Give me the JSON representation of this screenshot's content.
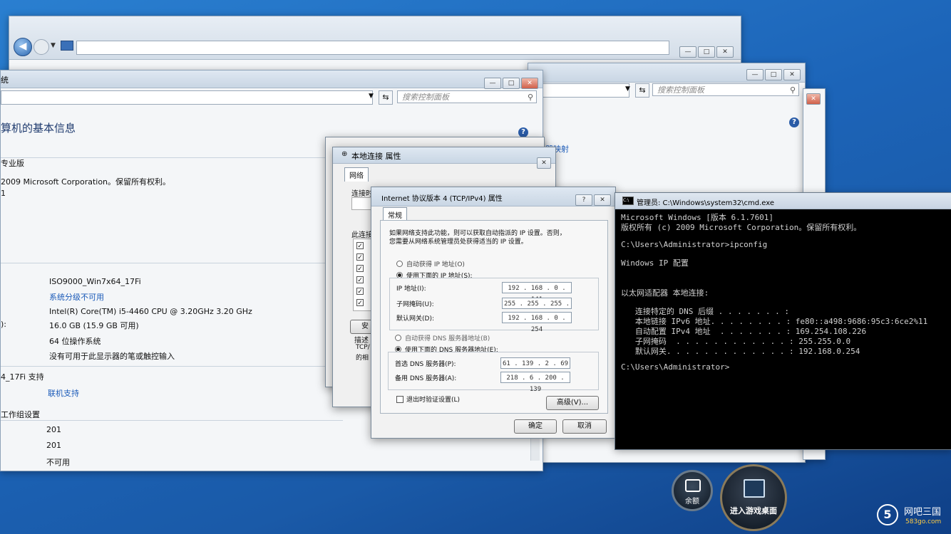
{
  "back_window": {
    "controls": [
      "—",
      "□",
      "✕"
    ]
  },
  "panel_right": {
    "search_placeholder": "搜索控制面板",
    "controls": [
      "—",
      "□",
      "✕"
    ]
  },
  "sysinfo": {
    "title_fragment": "统",
    "search_placeholder": "搜索控制面板",
    "heading": "算机的基本信息",
    "edition": "专业版",
    "copyright": "2009 Microsoft Corporation。保留所有权利。",
    "sp": "1",
    "computer_name": "ISO9000_Win7x64_17Fi",
    "rating": "系统分级不可用",
    "processor": "Intel(R) Core(TM) i5-4460  CPU @ 3.20GHz   3.20 GHz",
    "ram_label": "):",
    "ram": "16.0 GB (15.9 GB 可用)",
    "system_type": "64 位操作系统",
    "pen": "没有可用于此显示器的笔或触控输入",
    "support_label": "4_17Fi 支持",
    "support_link": "联机支持",
    "workgroup_label": "工作组设置",
    "val1": "201",
    "val2": "201",
    "val3": "不可用",
    "side_link": "器映射"
  },
  "local_conn": {
    "title": "本地连接 属性",
    "tab": "网络",
    "connect_label": "连接时",
    "uses_label": "此连接",
    "install_btn": "安",
    "desc_label": "描述",
    "desc_l1": "TCP/",
    "desc_l2": "的相"
  },
  "ipv4": {
    "title": "Internet 协议版本 4 (TCP/IPv4) 属性",
    "tab": "常规",
    "intro_l1": "如果网络支持此功能，则可以获取自动指派的 IP 设置。否则，",
    "intro_l2": "您需要从网络系统管理员处获得适当的 IP 设置。",
    "auto_ip": "自动获得 IP 地址(O)",
    "use_ip": "使用下面的 IP 地址(S):",
    "ip_label": "IP 地址(I):",
    "ip": "192 . 168 .  0  . 141",
    "mask_label": "子网掩码(U):",
    "mask": "255 . 255 . 255 .  0",
    "gw_label": "默认网关(D):",
    "gw": "192 . 168 .  0  . 254",
    "auto_dns": "自动获得 DNS 服务器地址(B)",
    "use_dns": "使用下面的 DNS 服务器地址(E):",
    "dns1_label": "首选 DNS 服务器(P):",
    "dns1": "61 . 139 .  2  . 69",
    "dns2_label": "备用 DNS 服务器(A):",
    "dns2": "218 .  6  . 200 . 139",
    "validate": "退出时验证设置(L)",
    "advanced": "高级(V)...",
    "ok": "确定",
    "cancel": "取消",
    "help": "?",
    "close": "✕"
  },
  "cmd": {
    "title": "管理员: C:\\Windows\\system32\\cmd.exe",
    "lines": [
      "Microsoft Windows [版本 6.1.7601]",
      "版权所有 (c) 2009 Microsoft Corporation。保留所有权利。",
      "",
      "C:\\Users\\Administrator>ipconfig",
      "",
      "Windows IP 配置",
      "",
      "",
      "以太网适配器 本地连接:",
      "",
      "   连接特定的 DNS 后缀 . . . . . . . :",
      "   本地链接 IPv6 地址. . . . . . . . : fe80::a498:9686:95c3:6ce2%11",
      "   自动配置 IPv4 地址  . . . . . . . : 169.254.108.226",
      "   子网掩码  . . . . . . . . . . . . : 255.255.0.0",
      "   默认网关. . . . . . . . . . . . . : 192.168.0.254",
      "",
      "C:\\Users\\Administrator>"
    ]
  },
  "taskbar": {
    "balance": "余额",
    "enter_desktop": "进入游戏桌面",
    "brand": "网吧三国",
    "brand_url": "583go.com",
    "brand_num": "5"
  }
}
